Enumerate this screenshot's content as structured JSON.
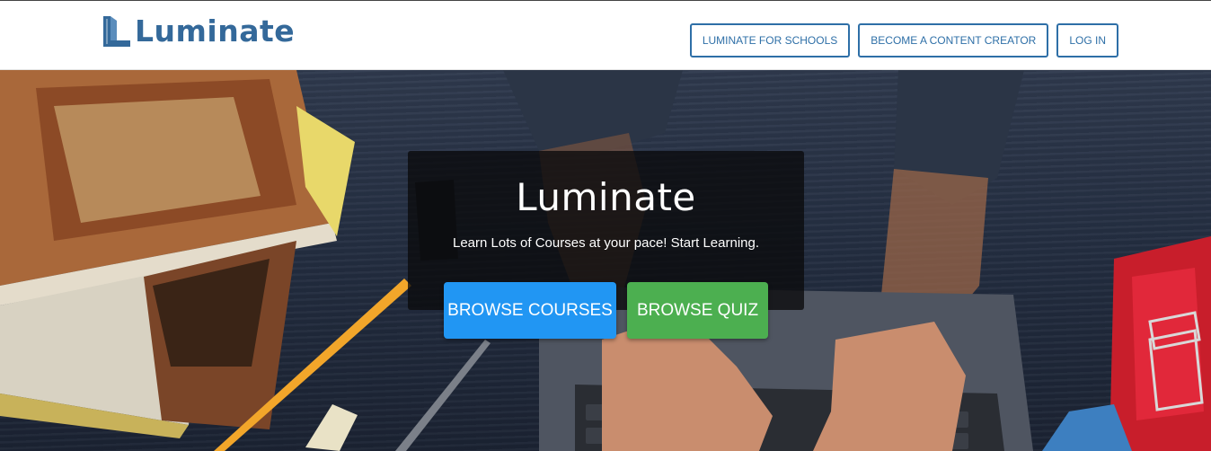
{
  "header": {
    "logo_text": "Luminate",
    "nav": [
      {
        "label": "LUMINATE FOR SCHOOLS"
      },
      {
        "label": "BECOME A CONTENT CREATOR"
      },
      {
        "label": "LOG IN"
      }
    ]
  },
  "hero": {
    "title": "Luminate",
    "subtitle": "Learn Lots of Courses at your pace! Start Learning.",
    "buttons": {
      "courses": "BROWSE COURSES",
      "quiz": "BROWSE QUIZ"
    }
  },
  "colors": {
    "brand": "#34699a",
    "nav_border": "#2e6fa7",
    "courses_button": "#2196f3",
    "quiz_button": "#4caf50"
  },
  "icons": [
    "luminate-logo-mark"
  ]
}
